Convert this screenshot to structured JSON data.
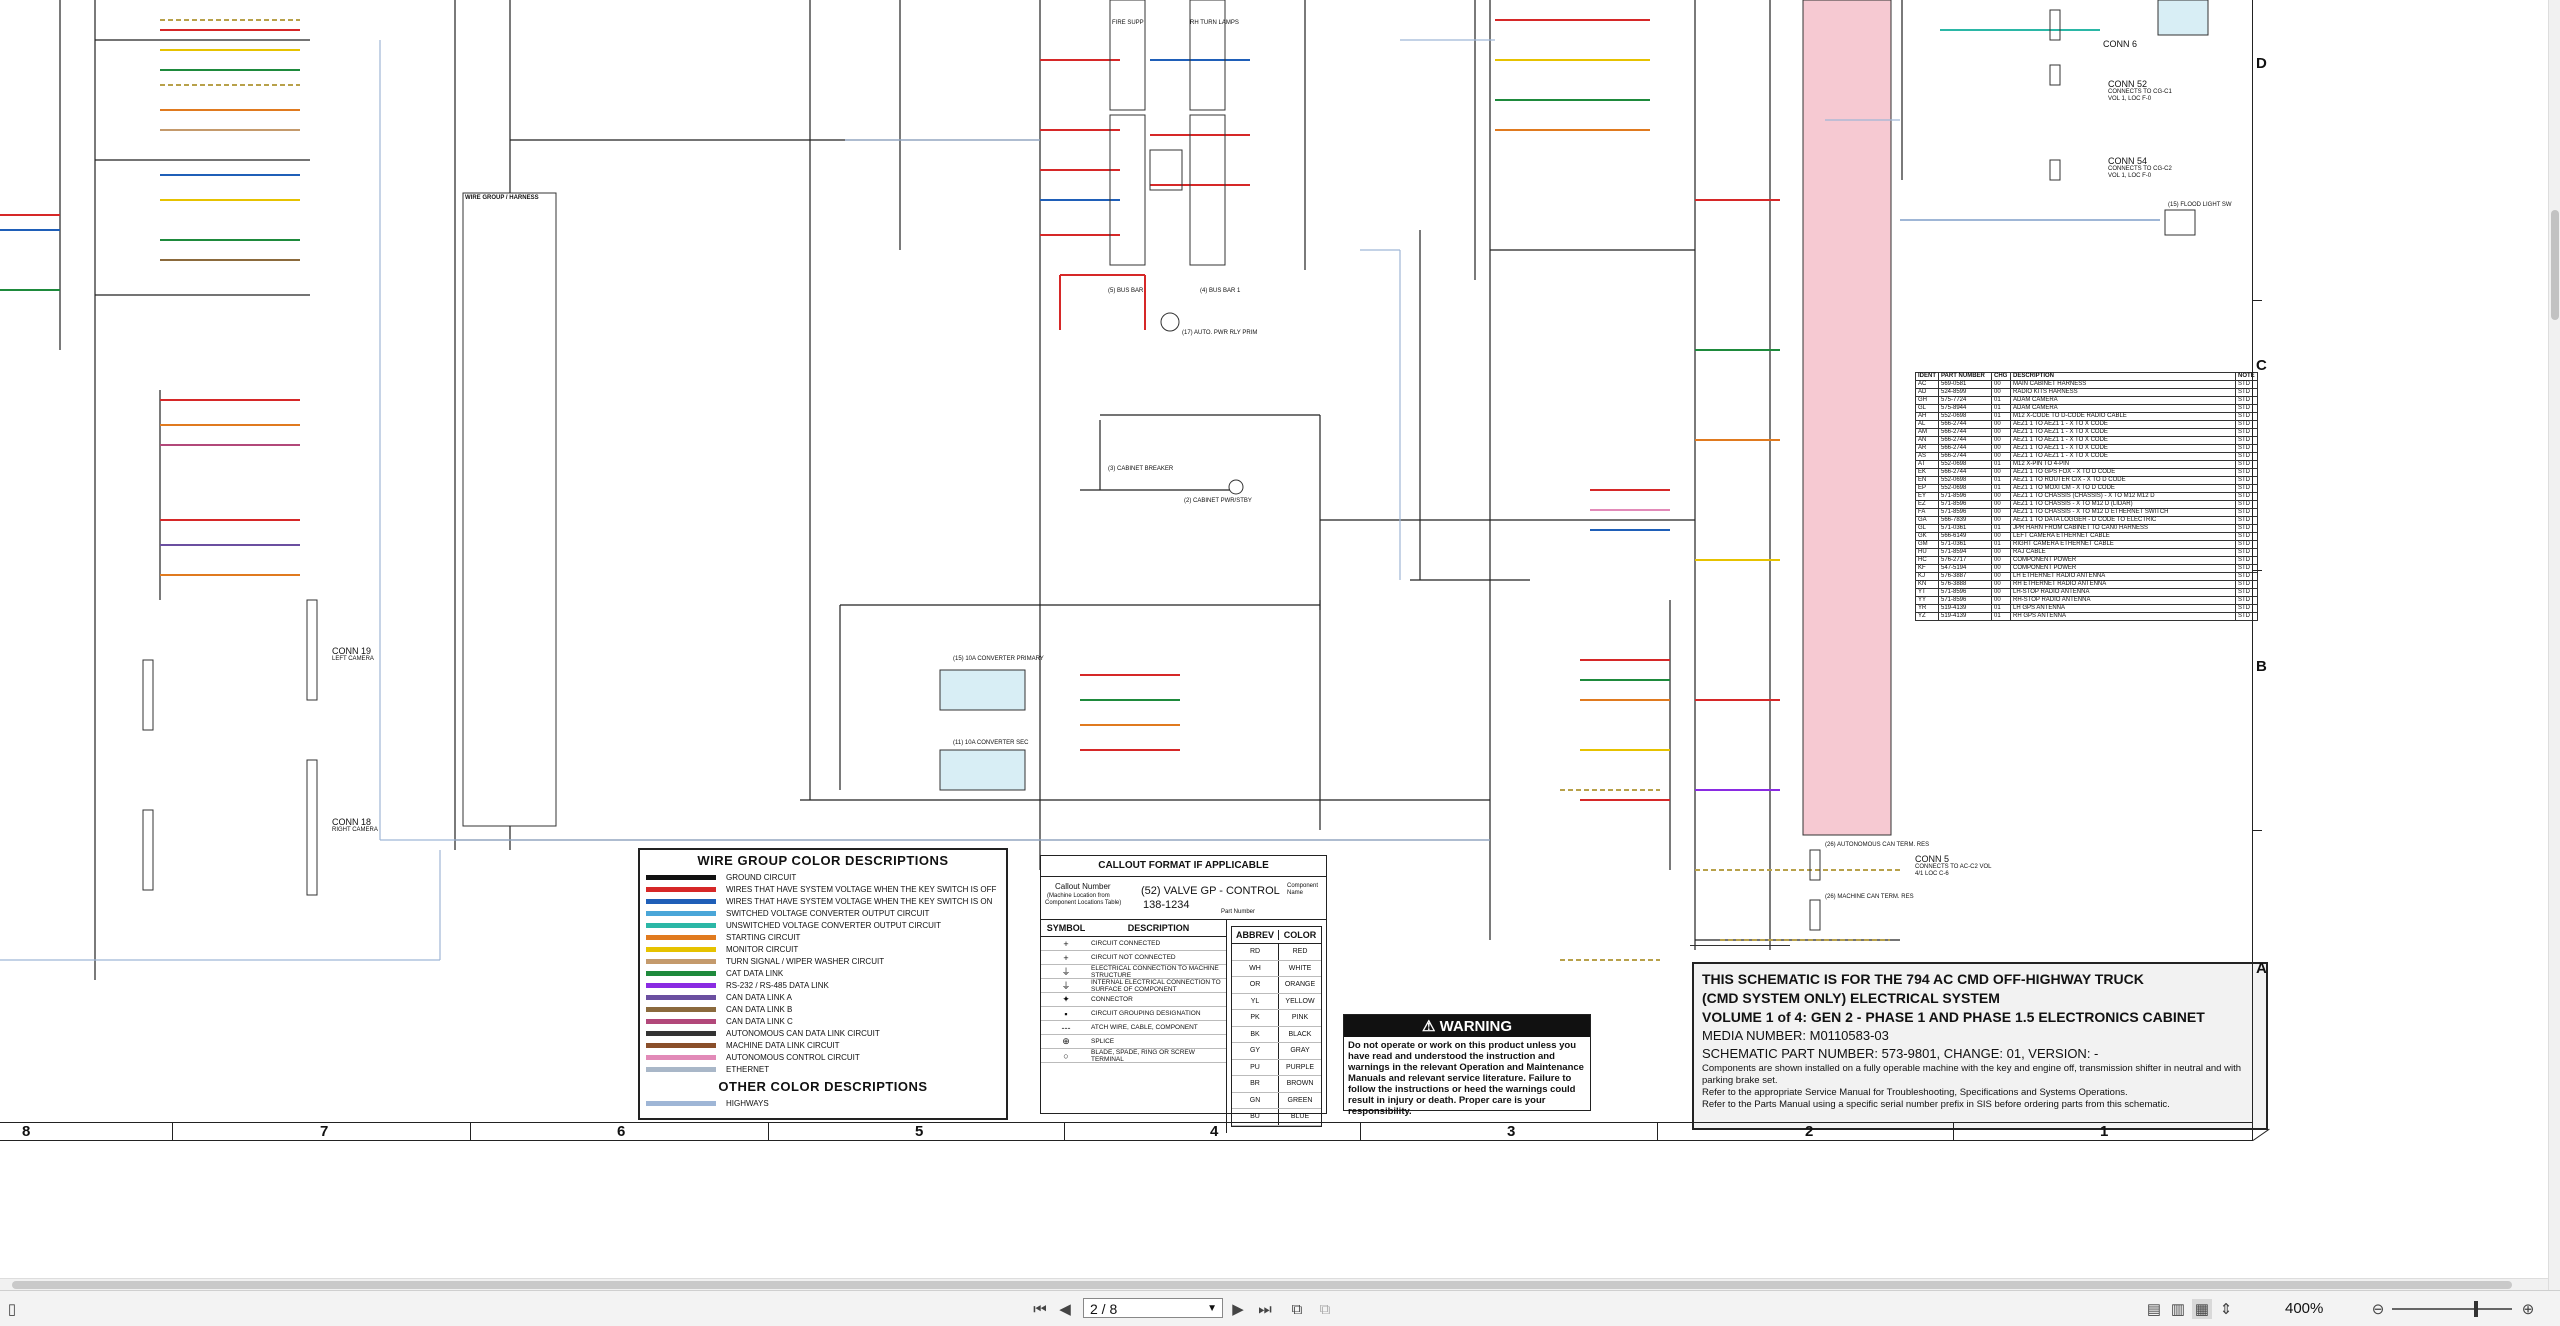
{
  "wire_group": {
    "title": "WIRE GROUP COLOR DESCRIPTIONS",
    "items": [
      {
        "label": "GROUND CIRCUIT",
        "color": "#111111"
      },
      {
        "label": "WIRES THAT HAVE SYSTEM VOLTAGE WHEN THE KEY SWITCH IS OFF",
        "color": "#d62828"
      },
      {
        "label": "WIRES THAT HAVE SYSTEM VOLTAGE WHEN THE KEY SWITCH IS ON",
        "color": "#1f5fb8"
      },
      {
        "label": "SWITCHED VOLTAGE CONVERTER OUTPUT CIRCUIT",
        "color": "#4aa6d8"
      },
      {
        "label": "UNSWITCHED VOLTAGE CONVERTER OUTPUT CIRCUIT",
        "color": "#2bb7a6"
      },
      {
        "label": "STARTING CIRCUIT",
        "color": "#e07a1f"
      },
      {
        "label": "MONITOR CIRCUIT",
        "color": "#e6c200"
      },
      {
        "label": "TURN SIGNAL / WIPER WASHER CIRCUIT",
        "color": "#c49a6c"
      },
      {
        "label": "CAT DATA LINK",
        "color": "#1e8a3c"
      },
      {
        "label": "RS-232 / RS-485 DATA LINK",
        "color": "#8a2be2"
      },
      {
        "label": "CAN DATA LINK A",
        "color": "#6b4fa0"
      },
      {
        "label": "CAN DATA LINK B",
        "color": "#8b6a3d"
      },
      {
        "label": "CAN DATA LINK C",
        "color": "#b2487a"
      },
      {
        "label": "AUTONOMOUS CAN DATA LINK CIRCUIT",
        "color": "#333333"
      },
      {
        "label": "MACHINE DATA LINK CIRCUIT",
        "color": "#8a4f2a"
      },
      {
        "label": "AUTONOMOUS CONTROL CIRCUIT",
        "color": "#e28ab8"
      },
      {
        "label": "ETHERNET",
        "color": "#a9b7c8"
      }
    ],
    "other_title": "OTHER COLOR DESCRIPTIONS",
    "other_items": [
      {
        "label": "HIGHWAYS",
        "color": "#9fb6d6"
      }
    ]
  },
  "callout": {
    "title": "CALLOUT FORMAT IF APPLICABLE",
    "line1": "Callout Number",
    "line2": "(Machine Location from",
    "line3": "Component Locations Table)",
    "example": "(52) VALVE GP - CONTROL",
    "example_num": "138-1234",
    "component_name": "Component Name",
    "part_number": "Part Number",
    "symbol_head": "SYMBOL",
    "desc_head": "DESCRIPTION",
    "symbols": [
      {
        "sym": "+",
        "desc": "CIRCUIT CONNECTED"
      },
      {
        "sym": "+",
        "desc": "CIRCUIT NOT CONNECTED"
      },
      {
        "sym": "⏚",
        "desc": "ELECTRICAL CONNECTION TO MACHINE STRUCTURE"
      },
      {
        "sym": "⏚",
        "desc": "INTERNAL ELECTRICAL CONNECTION TO SURFACE OF COMPONENT"
      },
      {
        "sym": "✦",
        "desc": "CONNECTOR"
      },
      {
        "sym": "▪",
        "desc": "CIRCUIT GROUPING DESIGNATION"
      },
      {
        "sym": "---",
        "desc": "ATCH WIRE, CABLE, COMPONENT"
      },
      {
        "sym": "⊕",
        "desc": "SPLICE"
      },
      {
        "sym": "○",
        "desc": "BLADE, SPADE, RING OR SCREW TERMINAL"
      }
    ],
    "abbrev_head": "ABBREV",
    "color_head": "COLOR",
    "abbrevs": [
      {
        "a": "RD",
        "c": "RED"
      },
      {
        "a": "WH",
        "c": "WHITE"
      },
      {
        "a": "OR",
        "c": "ORANGE"
      },
      {
        "a": "YL",
        "c": "YELLOW"
      },
      {
        "a": "PK",
        "c": "PINK"
      },
      {
        "a": "BK",
        "c": "BLACK"
      },
      {
        "a": "GY",
        "c": "GRAY"
      },
      {
        "a": "PU",
        "c": "PURPLE"
      },
      {
        "a": "BR",
        "c": "BROWN"
      },
      {
        "a": "GN",
        "c": "GREEN"
      },
      {
        "a": "BU",
        "c": "BLUE"
      }
    ]
  },
  "warning": {
    "title": "WARNING",
    "text": "Do not operate or work on this product unless you have read and understood the instruction and warnings in the relevant Operation and Maintenance Manuals and relevant service literature. Failure to follow the instructions or heed the warnings could result in injury or death. Proper care is your responsibility."
  },
  "title_block": {
    "line1": "THIS SCHEMATIC IS FOR THE 794 AC CMD OFF-HIGHWAY TRUCK",
    "line2": "(CMD SYSTEM ONLY) ELECTRICAL SYSTEM",
    "line3": "VOLUME 1 of 4: GEN 2 - PHASE 1 AND PHASE 1.5 ELECTRONICS CABINET",
    "media": "MEDIA NUMBER: M0110583-03",
    "schematic": "SCHEMATIC PART NUMBER: 573-9801, CHANGE: 01, VERSION: -",
    "note1": "Components are shown installed on a fully operable machine with the key and engine off, transmission shifter in neutral and with parking brake set.",
    "note2": "Refer to the appropriate Service Manual for Troubleshooting, Specifications and Systems Operations.",
    "note3": "Refer to the Parts Manual using a specific serial number prefix in SIS before ordering parts from this schematic."
  },
  "zones_bottom": [
    "8",
    "7",
    "6",
    "5",
    "4",
    "3",
    "2",
    "1"
  ],
  "zones_right": [
    "D",
    "C",
    "B",
    "A"
  ],
  "connectors": [
    {
      "name": "CONN 19",
      "desc": "LEFT CAMERA"
    },
    {
      "name": "CONN 18",
      "desc": "RIGHT CAMERA"
    },
    {
      "name": "CONN 6",
      "desc": ""
    },
    {
      "name": "CONN 52",
      "desc": "CONNECTS TO CG-C1 VOL 1, LOC F-0"
    },
    {
      "name": "CONN 54",
      "desc": "CONNECTS TO CG-C2 VOL 1, LOC F-0"
    },
    {
      "name": "CONN 5",
      "desc": "CONNECTS TO AC-C2 VOL 4/1 LOC C-6"
    }
  ],
  "components": [
    {
      "label": "FIRE SUPP"
    },
    {
      "label": "RH TURN LAMPS"
    },
    {
      "label": "(5) BUS BAR"
    },
    {
      "label": "(4) BUS BAR 1"
    },
    {
      "label": "(17) AUTO. PWR RLY PRIM"
    },
    {
      "label": "(3) CABINET BREAKER"
    },
    {
      "label": "(2) CABINET PWR/STBY"
    },
    {
      "label": "(15) 10A CONVERTER PRIMARY"
    },
    {
      "label": "(11) 10A CONVERTER SEC"
    },
    {
      "label": "(26) AUTONOMOUS CAN TERM. RES"
    },
    {
      "label": "(26) MACHINE CAN TERM. RES"
    },
    {
      "label": "(15) FLOOD LIGHT SW"
    }
  ],
  "wire_table_head": [
    "WIRE GROUP",
    "HARNESS"
  ],
  "harness_table": {
    "headers": [
      "IDENT",
      "PART NUMBER",
      "CHG",
      "DESCRIPTION",
      "NOTE"
    ],
    "rows": [
      [
        "AC",
        "569-0581",
        "00",
        "MAIN CABINET HARNESS",
        "STD"
      ],
      [
        "AD",
        "524-8599",
        "00",
        "RADIO KITS HARNESS",
        "STD"
      ],
      [
        "GH",
        "575-7724",
        "01",
        "ADAM CAMERA",
        "STD"
      ],
      [
        "GL",
        "575-8944",
        "01",
        "ADAM CAMERA",
        "STD"
      ],
      [
        "AH",
        "552-0698",
        "01",
        "M12 X-CODE TO D-CODE RADIO CABLE",
        "STD"
      ],
      [
        "AL",
        "566-2744",
        "00",
        "AEZ1 1 TO AEZ1 1 - X TO X CODE",
        "STD"
      ],
      [
        "AM",
        "566-2744",
        "00",
        "AEZ1 1 TO AEZ1 1 - X TO X CODE",
        "STD"
      ],
      [
        "AN",
        "566-2744",
        "00",
        "AEZ1 1 TO AEZ1 1 - X TO X CODE",
        "STD"
      ],
      [
        "AR",
        "566-2744",
        "00",
        "AEZ1 1 TO AEZ1 1 - X TO X CODE",
        "STD"
      ],
      [
        "AS",
        "566-2744",
        "00",
        "AEZ1 1 TO AEZ1 1 - X TO X CODE",
        "STD"
      ],
      [
        "AT",
        "552-0698",
        "01",
        "M12 X-PIN TO 4-PIN",
        "STD"
      ],
      [
        "EK",
        "566-2744",
        "00",
        "AEZ1 1 TO GPS FOX - X TO D CODE",
        "STD"
      ],
      [
        "EN",
        "552-0698",
        "01",
        "AEZ1 1 TO ROUTER C/X - X TO D CODE",
        "STD"
      ],
      [
        "EP",
        "552-0698",
        "01",
        "AEZ1 1 TO MOXI CM - X TO D CODE",
        "STD"
      ],
      [
        "EY",
        "571-8596",
        "00",
        "AEZ1 1 TO CHASSIS (CHASSIS) - X TO M12 M12 D",
        "STD"
      ],
      [
        "EZ",
        "571-8596",
        "00",
        "AEZ1 1 TO CHASSIS - X TO M12 D (LIDAR)",
        "STD"
      ],
      [
        "FA",
        "571-8596",
        "00",
        "AEZ1 1 TO CHASSIS - X TO M12 D ETHERNET SWITCH",
        "STD"
      ],
      [
        "GA",
        "566-7839",
        "00",
        "AEZ1 1 TO DATA LOGGER - D CODE TO ELECTRIC",
        "STD"
      ],
      [
        "GL",
        "571-0361",
        "01",
        "JPR HARN FROM CABINET TO CAN0 HARNESS",
        "STD"
      ],
      [
        "GK",
        "566-6149",
        "00",
        "LEFT CAMERA ETHERNET CABLE",
        "STD"
      ],
      [
        "GM",
        "571-0361",
        "01",
        "RIGHT CAMERA ETHERNET CABLE",
        "STD"
      ],
      [
        "HU",
        "571-8594",
        "00",
        "RAJ CABLE",
        "STD"
      ],
      [
        "HC",
        "576-2717",
        "00",
        "COMPONENT POWER",
        "STD"
      ],
      [
        "KF",
        "547-5194",
        "00",
        "COMPONENT POWER",
        "STD"
      ],
      [
        "KJ",
        "576-3887",
        "00",
        "LH ETHERNET RADIO ANTENNA",
        "STD"
      ],
      [
        "KN",
        "576-3888",
        "00",
        "RH ETHERNET RADIO ANTENNA",
        "STD"
      ],
      [
        "YT",
        "571-8596",
        "00",
        "LH-STOP RADIO ANTENNA",
        "STD"
      ],
      [
        "YY",
        "571-8596",
        "00",
        "RH-STOP RADIO ANTENNA",
        "STD"
      ],
      [
        "YR",
        "519-4139",
        "01",
        "LH GPS ANTENNA",
        "STD"
      ],
      [
        "YZ",
        "519-4139",
        "01",
        "RH GPS ANTENNA",
        "STD"
      ]
    ]
  },
  "viewer": {
    "page_indicator": "2 / 8",
    "zoom": "400%"
  }
}
